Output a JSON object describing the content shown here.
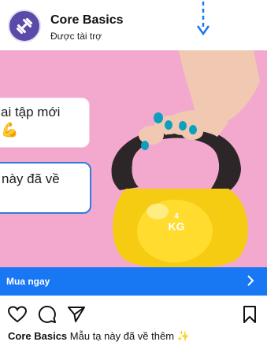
{
  "header": {
    "brand_name": "Core Basics",
    "sponsored_label": "Được tài trợ",
    "avatar_icon": "dumbbell-icon",
    "menu_icon": "arrow-down-icon"
  },
  "media": {
    "bubble_1_line_1": "ai tập mới",
    "bubble_2_line_1": "này đã về",
    "kettlebell_weight": "4",
    "kettlebell_unit": "KG"
  },
  "cta": {
    "label": "Mua ngay",
    "icon": "chevron-right-icon",
    "color": "#1877f2"
  },
  "actions": {
    "icons": [
      "heart-icon",
      "comment-icon",
      "share-icon",
      "bookmark-icon"
    ]
  },
  "caption": {
    "author": "Core Basics",
    "text": "Mẫu tạ này đã về thêm ✨"
  }
}
